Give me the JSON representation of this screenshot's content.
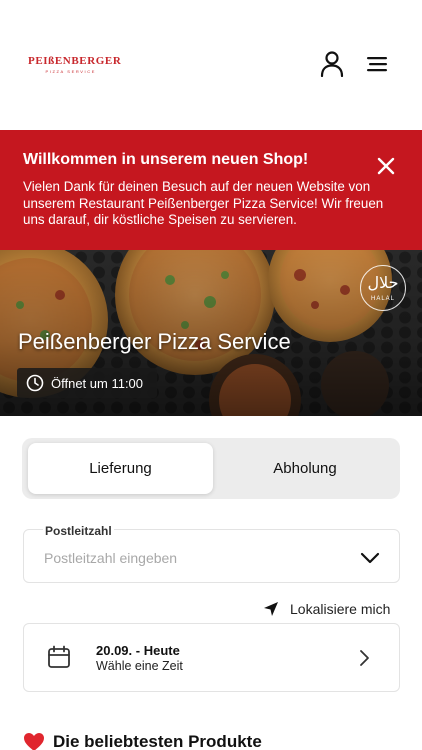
{
  "header": {
    "logo_text": "PEIßENBERGER",
    "logo_subtext": "PIZZA SERVICE",
    "icons": [
      "user-icon",
      "hamburger-menu-icon"
    ]
  },
  "banner": {
    "title": "Willkommen in unserem neuen Shop!",
    "text": "Vielen Dank für deinen Besuch auf der neuen Website von unserem Restaurant Peißenberger Pizza Service! Wir freuen uns darauf, dir köstliche Speisen zu servieren.",
    "close_icon": "close-icon",
    "background_color": "#c5171f"
  },
  "hero": {
    "restaurant_name": "Peißenberger Pizza Service",
    "opening_status": "Öffnet um 11:00",
    "halal_logo_arabic": "حلال",
    "halal_logo_text": "HALAL"
  },
  "order_mode": {
    "options": [
      {
        "label": "Lieferung",
        "active": true
      },
      {
        "label": "Abholung",
        "active": false
      }
    ]
  },
  "postal_code": {
    "label": "Postleitzahl",
    "value": "",
    "placeholder": "Postleitzahl eingeben"
  },
  "locate": {
    "label": "Lokalisiere mich",
    "icon": "location-arrow-icon"
  },
  "time_selector": {
    "date": "20.09. - Heute",
    "subtitle": "Wähle eine Zeit",
    "icon": "calendar-icon"
  },
  "popular_section": {
    "title": "Die beliebtesten Produkte",
    "icon": "heart-icon"
  }
}
